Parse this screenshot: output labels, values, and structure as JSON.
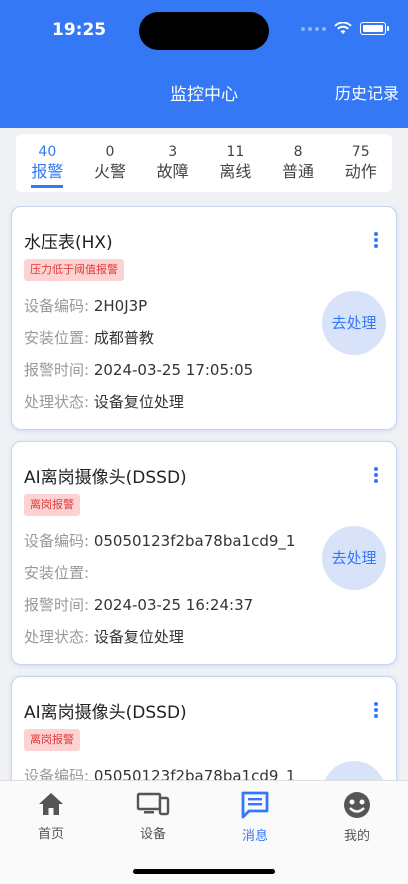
{
  "status_bar": {
    "time": "19:25"
  },
  "header": {
    "title": "监控中心",
    "history_label": "历史记录"
  },
  "tabs": [
    {
      "count": "40",
      "label": "报警",
      "active": true
    },
    {
      "count": "0",
      "label": "火警"
    },
    {
      "count": "3",
      "label": "故障"
    },
    {
      "count": "11",
      "label": "离线"
    },
    {
      "count": "8",
      "label": "普通"
    },
    {
      "count": "75",
      "label": "动作"
    }
  ],
  "field_labels": {
    "code": "设备编码:",
    "location": "安装位置:",
    "alarm_time": "报警时间:",
    "status": "处理状态:"
  },
  "process_label": "去处理",
  "cards": [
    {
      "title": "水压表(HX)",
      "badge": "压力低于阈值报警",
      "code": "2H0J3P",
      "location": "成都普教",
      "alarm_time": "2024-03-25 17:05:05",
      "status": "设备复位处理"
    },
    {
      "title": "AI离岗摄像头(DSSD)",
      "badge": "离岗报警",
      "code": "05050123f2ba78ba1cd9_1",
      "location": "",
      "alarm_time": "2024-03-25 16:24:37",
      "status": "设备复位处理"
    },
    {
      "title": "AI离岗摄像头(DSSD)",
      "badge": "离岗报警",
      "code": "05050123f2ba78ba1cd9_1",
      "location": "",
      "alarm_time": "",
      "status": ""
    }
  ],
  "bottom_nav": [
    {
      "label": "首页",
      "icon": "home-icon"
    },
    {
      "label": "设备",
      "icon": "device-icon"
    },
    {
      "label": "消息",
      "icon": "message-icon",
      "active": true
    },
    {
      "label": "我的",
      "icon": "profile-icon"
    }
  ],
  "colors": {
    "primary": "#3478f6",
    "badge_bg": "#fcd2d2",
    "badge_text": "#e23b3b"
  }
}
